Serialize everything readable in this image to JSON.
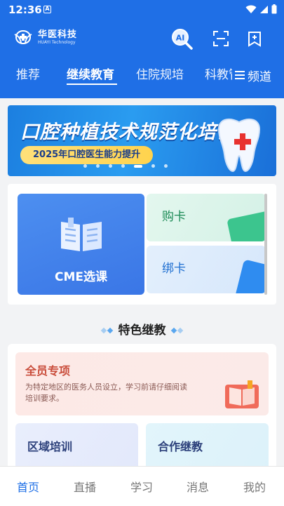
{
  "status": {
    "time": "12:36",
    "notif": "A"
  },
  "header": {
    "logo_cn": "华医科技",
    "logo_en": "HUAYI Technology",
    "ai_label": "AI"
  },
  "tabs": [
    {
      "label": "推荐"
    },
    {
      "label": "继续教育"
    },
    {
      "label": "住院规培"
    },
    {
      "label": "科教管"
    }
  ],
  "tabs_more": "频道",
  "banner": {
    "title": "口腔种植技术规范化培训",
    "subtitle": "2025年口腔医生能力提升"
  },
  "quick": {
    "cme": "CME选课",
    "buy": "购卡",
    "bind": "绑卡"
  },
  "section": {
    "title": "特色继教"
  },
  "features": {
    "full": {
      "title": "全员专项",
      "desc": "为特定地区的医务人员设立，学习前请仔细阅读培训要求。"
    },
    "left": {
      "title": "区域培训"
    },
    "right": {
      "title": "合作继教"
    }
  },
  "bottom_nav": [
    {
      "label": "首页"
    },
    {
      "label": "直播"
    },
    {
      "label": "学习"
    },
    {
      "label": "消息"
    },
    {
      "label": "我的"
    }
  ],
  "colors": {
    "primary": "#1f6fe6",
    "banner_pill": "#ffd34d",
    "feature_red": "#c94c3a"
  }
}
